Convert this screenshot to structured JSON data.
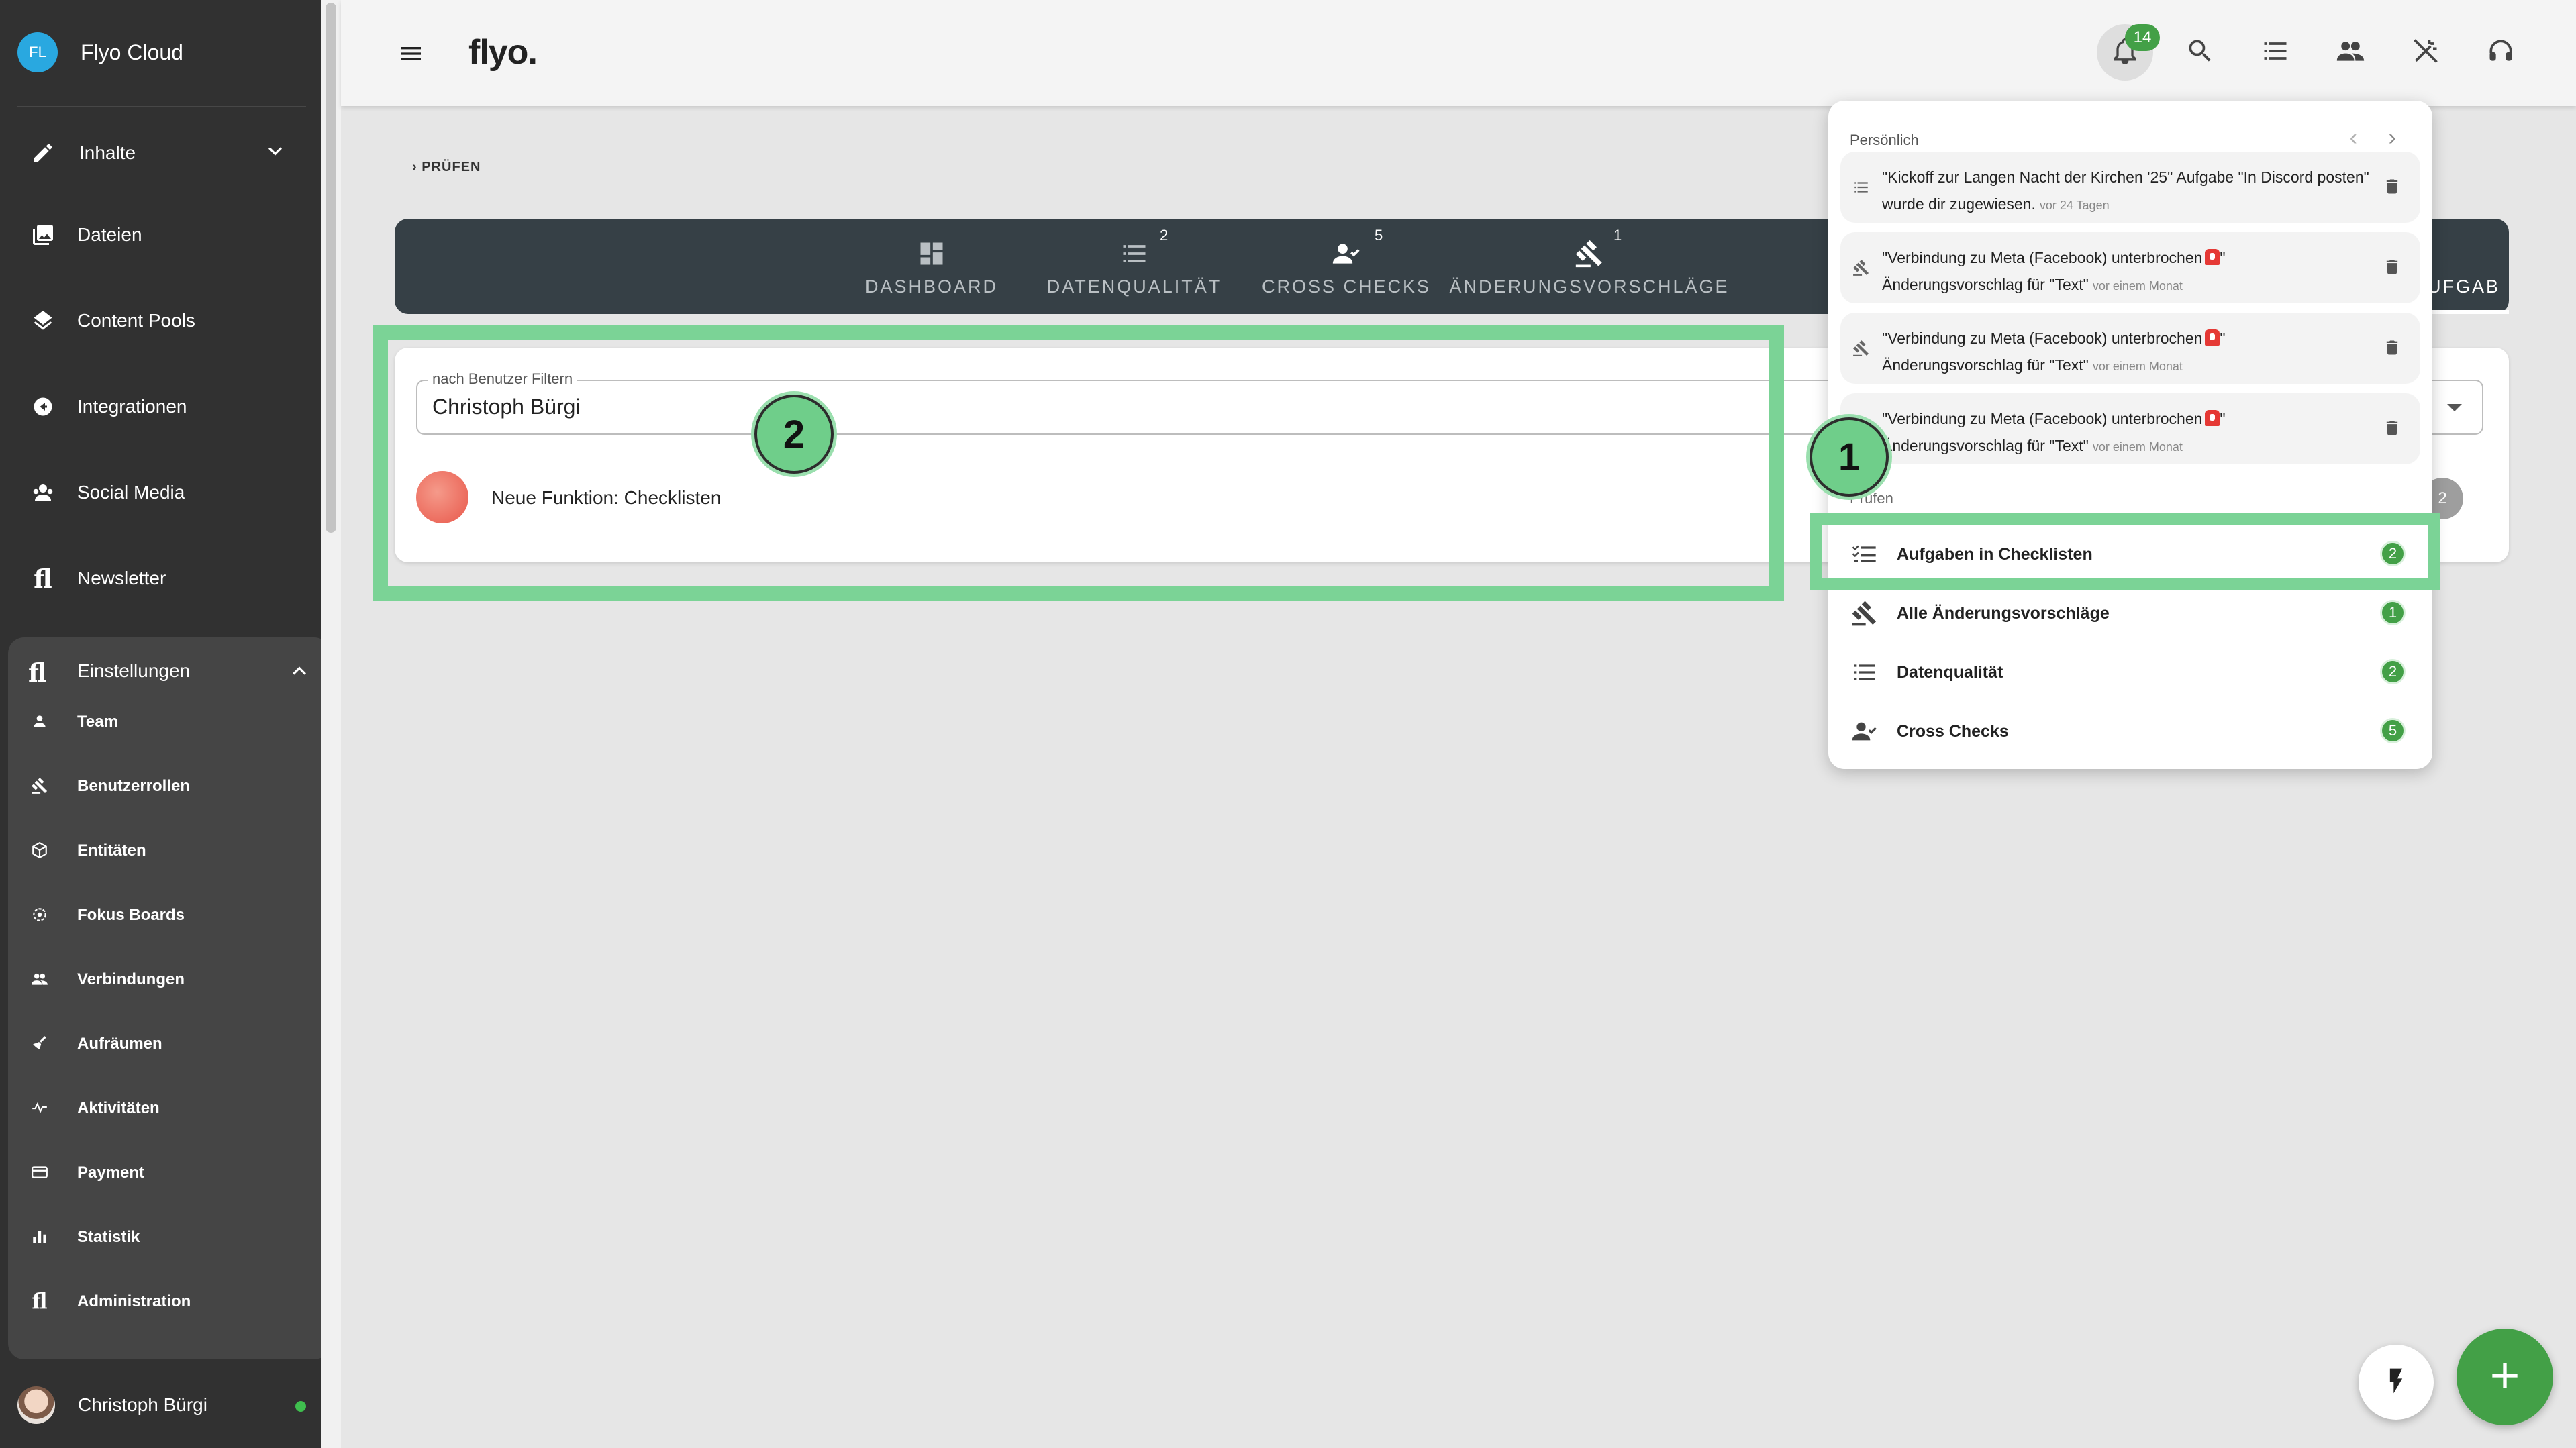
{
  "sidebar": {
    "brand_initials": "FL",
    "brand_name": "Flyo Cloud",
    "items": [
      {
        "label": "Inhalte",
        "icon": "pencil-icon"
      },
      {
        "label": "Dateien",
        "icon": "images-icon"
      },
      {
        "label": "Content Pools",
        "icon": "layers-icon"
      },
      {
        "label": "Integrationen",
        "icon": "integration-icon"
      },
      {
        "label": "Social Media",
        "icon": "social-icon"
      },
      {
        "label": "Newsletter",
        "icon": "flyo-logo-icon"
      }
    ],
    "settings": {
      "label": "Einstellungen",
      "items": [
        {
          "label": "Team",
          "icon": "person-icon"
        },
        {
          "label": "Benutzerrollen",
          "icon": "gavel-icon"
        },
        {
          "label": "Entitäten",
          "icon": "cube-icon"
        },
        {
          "label": "Fokus Boards",
          "icon": "target-icon"
        },
        {
          "label": "Verbindungen",
          "icon": "people-icon"
        },
        {
          "label": "Aufräumen",
          "icon": "broom-icon"
        },
        {
          "label": "Aktivitäten",
          "icon": "pulse-icon"
        },
        {
          "label": "Payment",
          "icon": "card-icon"
        },
        {
          "label": "Statistik",
          "icon": "bar-chart-icon"
        },
        {
          "label": "Administration",
          "icon": "flyo-logo-icon"
        }
      ]
    },
    "user": {
      "name": "Christoph Bürgi",
      "status": "online"
    }
  },
  "topbar": {
    "logo": "flyo.",
    "notification_count": "14",
    "icons": [
      "bell-icon",
      "search-icon",
      "checklist-icon",
      "people-icon",
      "magic-off-icon",
      "headset-icon"
    ]
  },
  "breadcrumb": "PRÜFEN",
  "tabs": [
    {
      "label": "DASHBOARD",
      "count": ""
    },
    {
      "label": "DATENQUALITÄT",
      "count": "2"
    },
    {
      "label": "CROSS CHECKS",
      "count": "5"
    },
    {
      "label": "ÄNDERUNGSVORSCHLÄGE",
      "count": "1"
    },
    {
      "label": "AUFGAB",
      "count": "",
      "active": true
    }
  ],
  "filter": {
    "label": "nach Benutzer Filtern",
    "value": "Christoph Bürgi"
  },
  "checklist_item": {
    "title": "Neue Funktion: Checklisten",
    "count": "2"
  },
  "markers": [
    "1",
    "2"
  ],
  "popover": {
    "personal_label": "Persönlich",
    "notifications": [
      {
        "text": "\"Kickoff zur Langen Nacht der Kirchen '25\" Aufgabe \"In Discord posten\" wurde dir zugewiesen.",
        "time": "vor 24 Tagen",
        "icon": "checklist-icon"
      },
      {
        "text1": "\"Verbindung zu Meta (Facebook) unterbrochen",
        "text2": "\"",
        "text3": "Änderungsvorschlag für \"Text\"",
        "time": "vor einem Monat",
        "icon": "gavel-icon"
      },
      {
        "text1": "\"Verbindung zu Meta (Facebook) unterbrochen",
        "text2": "\"",
        "text3": "Änderungsvorschlag für \"Text\"",
        "time": "vor einem Monat",
        "icon": "gavel-icon"
      },
      {
        "text1": "\"Verbindung zu Meta (Facebook) unterbrochen",
        "text2": "\"",
        "text3": "Änderungsvorschlag für \"Text\"",
        "time": "vor einem Monat",
        "icon": "gavel-icon"
      }
    ],
    "check_label": "Prüfen",
    "checks": [
      {
        "label": "Aufgaben in Checklisten",
        "count": "2",
        "icon": "checklist-icon"
      },
      {
        "label": "Alle Änderungsvorschläge",
        "count": "1",
        "icon": "gavel-icon"
      },
      {
        "label": "Datenqualität",
        "count": "2",
        "icon": "list-icon"
      },
      {
        "label": "Cross Checks",
        "count": "5",
        "icon": "person-check-icon"
      }
    ]
  },
  "colors": {
    "sidebar_bg": "#313131",
    "tabbar_bg": "#364046",
    "accent_green": "#43a047",
    "highlight_green": "#7bd396"
  }
}
